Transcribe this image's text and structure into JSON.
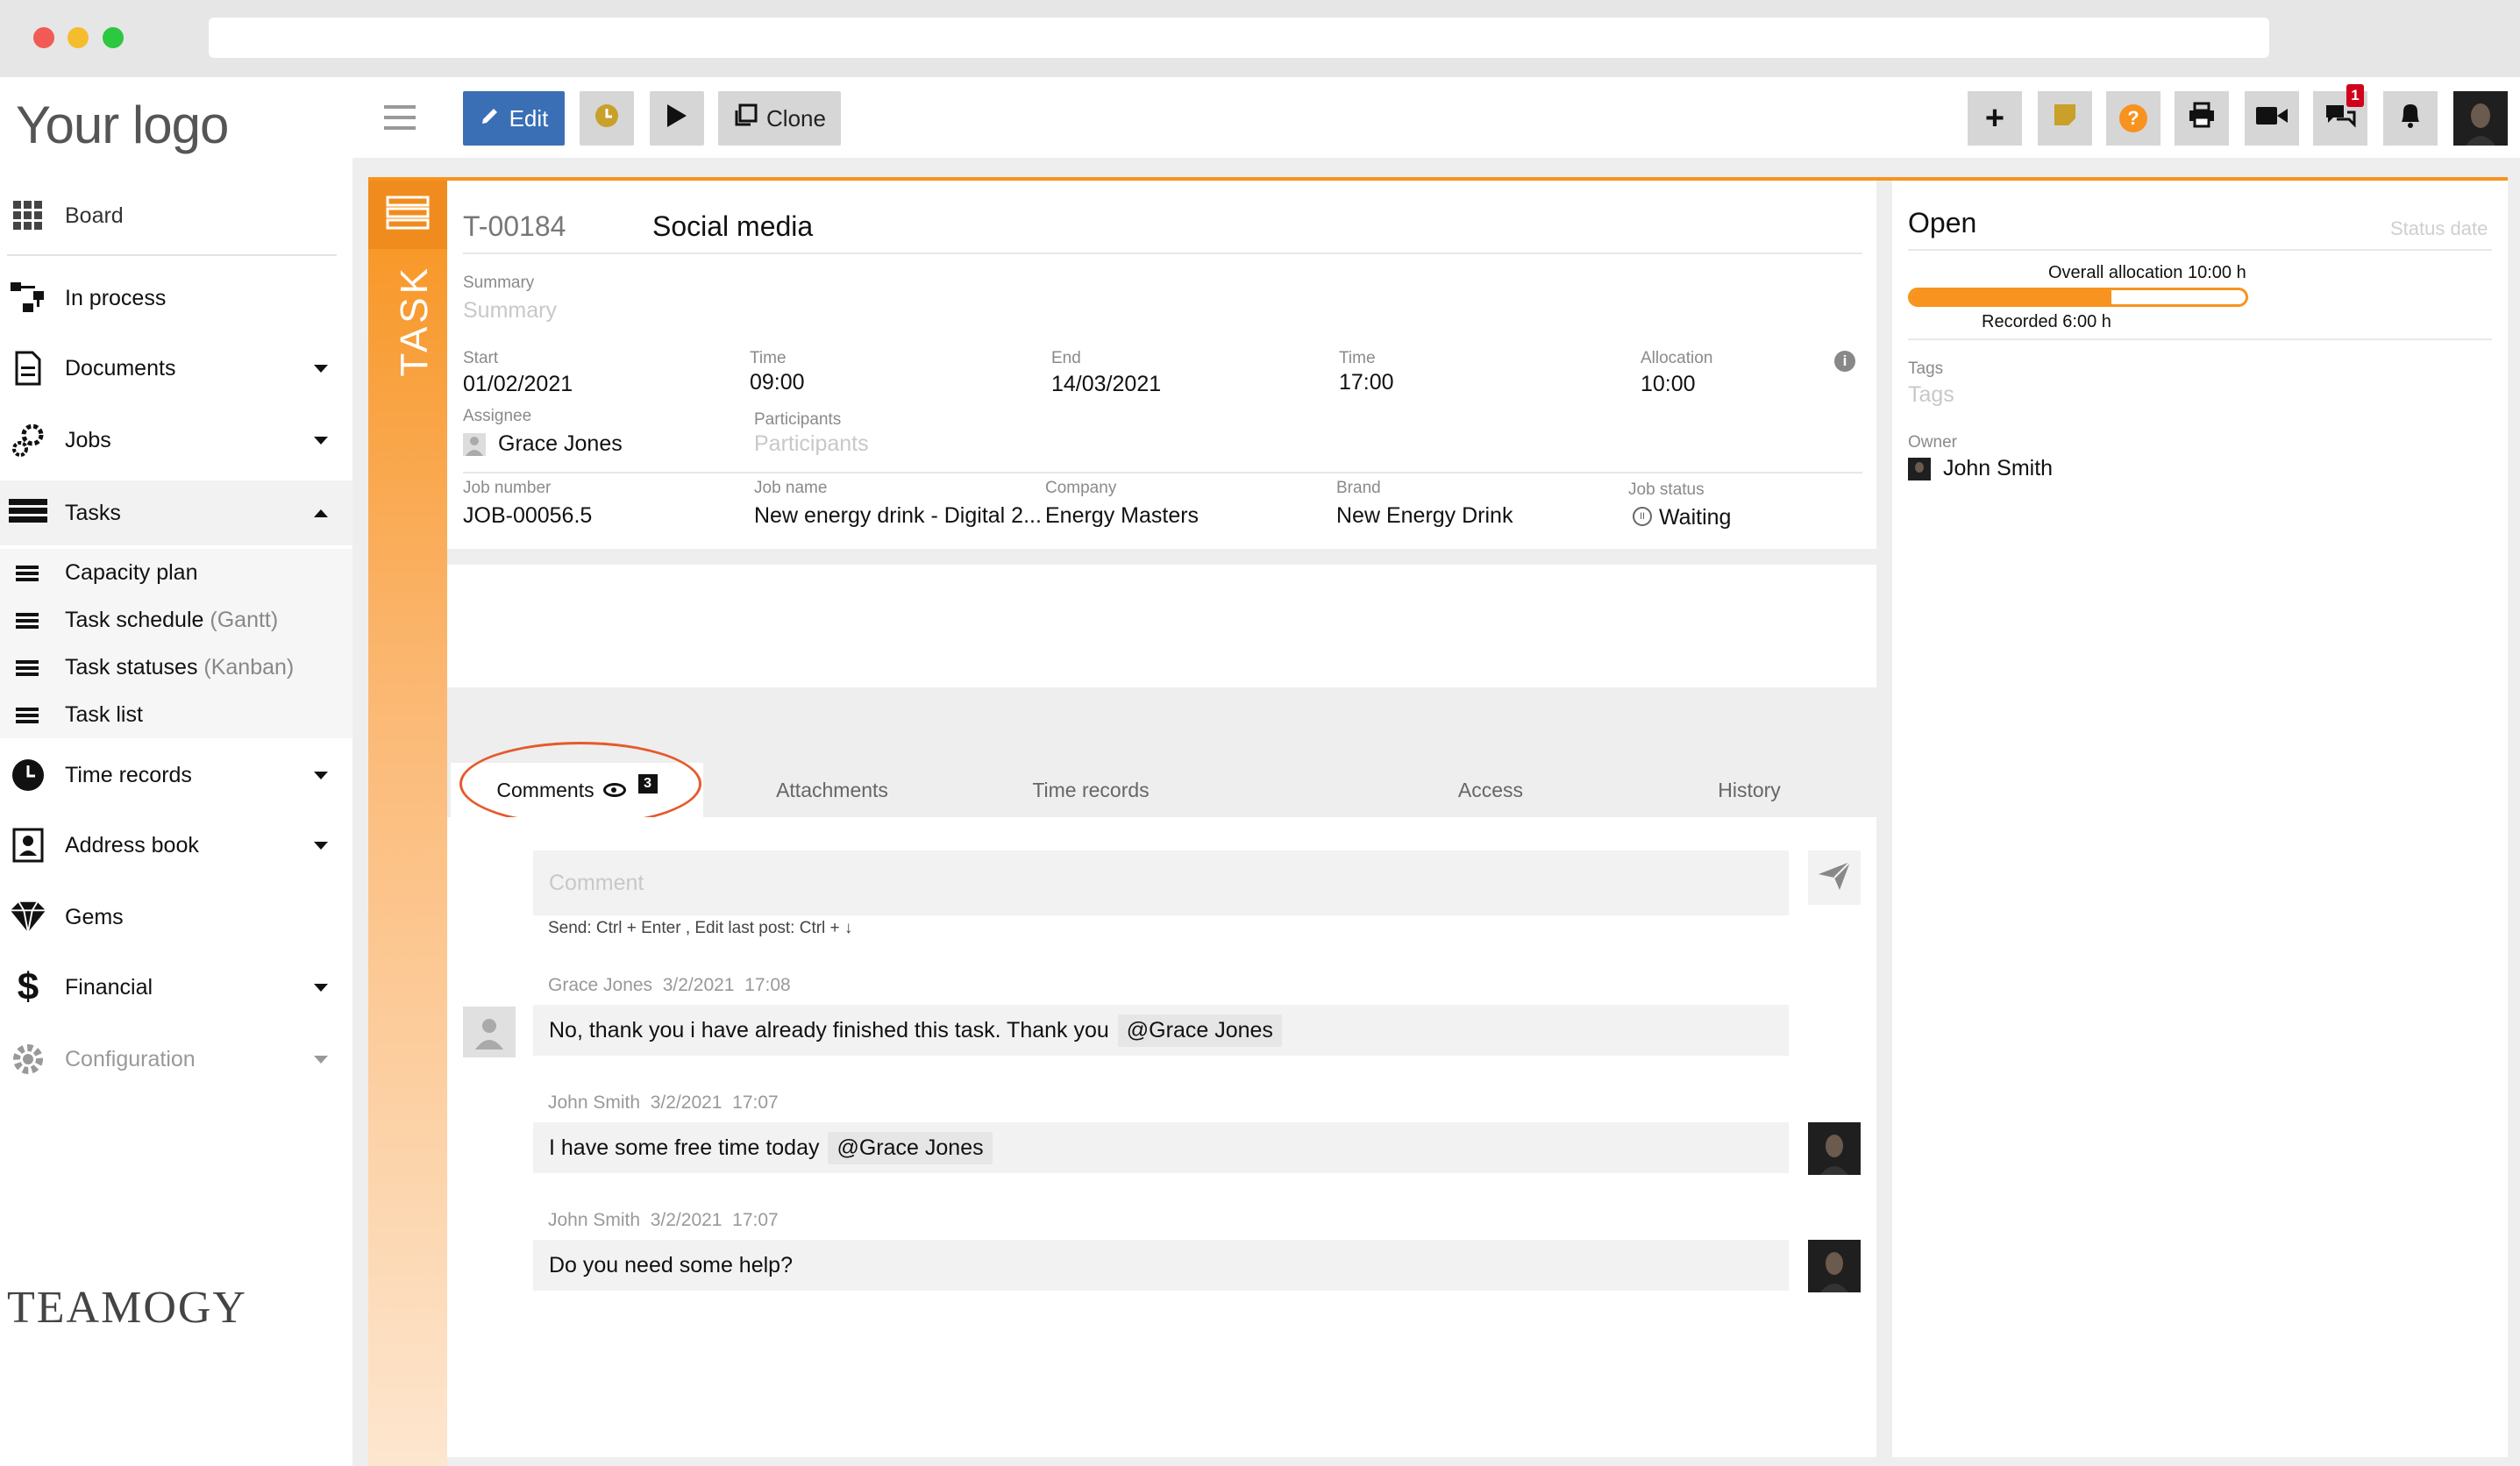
{
  "app": {
    "logo": "Your logo",
    "footer_brand": "TEAMOGY"
  },
  "sidebar": {
    "items": [
      {
        "label": "Board",
        "icon": "grid-icon"
      },
      {
        "label": "In process",
        "icon": "flow-icon"
      },
      {
        "label": "Documents",
        "icon": "document-icon"
      },
      {
        "label": "Jobs",
        "icon": "gears-icon"
      },
      {
        "label": "Tasks",
        "icon": "tasks-icon"
      },
      {
        "label": "Time records",
        "icon": "clock-icon"
      },
      {
        "label": "Address book",
        "icon": "contact-icon"
      },
      {
        "label": "Gems",
        "icon": "gem-icon"
      },
      {
        "label": "Financial",
        "icon": "dollar-icon"
      },
      {
        "label": "Configuration",
        "icon": "gear-icon"
      }
    ],
    "subitems": [
      {
        "label": "Capacity plan",
        "note": ""
      },
      {
        "label": "Task schedule",
        "note": "(Gantt)"
      },
      {
        "label": "Task statuses",
        "note": "(Kanban)"
      },
      {
        "label": "Task list",
        "note": ""
      }
    ]
  },
  "toolbar": {
    "edit_label": "Edit",
    "clone_label": "Clone",
    "chat_badge": "1"
  },
  "task": {
    "strip_label": "TASK",
    "id": "T-00184",
    "name": "Social media",
    "summary_label": "Summary",
    "summary_placeholder": "Summary",
    "start_label": "Start",
    "start_value": "01/02/2021",
    "start_time_label": "Time",
    "start_time_value": "09:00",
    "end_label": "End",
    "end_value": "14/03/2021",
    "end_time_label": "Time",
    "end_time_value": "17:00",
    "allocation_label": "Allocation",
    "allocation_value": "10:00",
    "assignee_label": "Assignee",
    "assignee_value": "Grace Jones",
    "participants_label": "Participants",
    "participants_placeholder": "Participants",
    "job_number_label": "Job number",
    "job_number_value": "JOB-00056.5",
    "job_name_label": "Job name",
    "job_name_value": "New energy drink - Digital 2...",
    "company_label": "Company",
    "company_value": "Energy Masters",
    "brand_label": "Brand",
    "brand_value": "New Energy Drink",
    "job_status_label": "Job status",
    "job_status_value": "Waiting"
  },
  "tabs": {
    "comments": "Comments",
    "comments_count": "3",
    "attachments": "Attachments",
    "time_records": "Time records",
    "access": "Access",
    "history": "History"
  },
  "comment_box": {
    "placeholder": "Comment",
    "hint": "Send: Ctrl + Enter , Edit last post: Ctrl + ↓"
  },
  "comments": [
    {
      "author": "Grace Jones",
      "date": "3/2/2021",
      "time": "17:08",
      "text": "No, thank you i have already finished this task. Thank you",
      "mention": "@Grace Jones",
      "side": "left"
    },
    {
      "author": "John Smith",
      "date": "3/2/2021",
      "time": "17:07",
      "text": "I have some free time today",
      "mention": "@Grace Jones",
      "side": "right"
    },
    {
      "author": "John Smith",
      "date": "3/2/2021",
      "time": "17:07",
      "text": "Do you need some help?",
      "mention": "",
      "side": "right"
    }
  ],
  "status_panel": {
    "status": "Open",
    "status_date_placeholder": "Status date",
    "overall_allocation": "Overall allocation 10:00 h",
    "recorded": "Recorded 6:00 h",
    "recorded_fraction": 0.6,
    "tags_label": "Tags",
    "tags_placeholder": "Tags",
    "owner_label": "Owner",
    "owner_value": "John Smith"
  },
  "colors": {
    "accent": "#f7931e",
    "edit_button": "#3a6fb5",
    "badge": "#d0021b"
  }
}
